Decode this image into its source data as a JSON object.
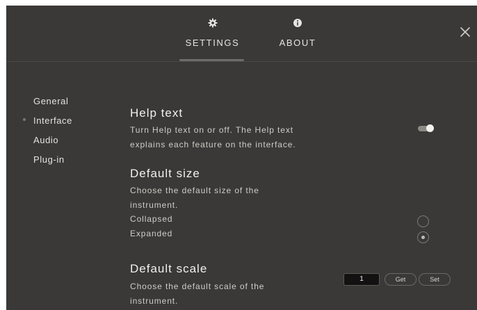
{
  "header": {
    "tabs": [
      {
        "label": "SETTINGS",
        "icon": "gear-icon"
      },
      {
        "label": "ABOUT",
        "icon": "info-icon"
      }
    ],
    "close_icon": "close-icon"
  },
  "sidebar": {
    "items": [
      {
        "label": "General"
      },
      {
        "label": "Interface",
        "active": true
      },
      {
        "label": "Audio"
      },
      {
        "label": "Plug-in"
      }
    ]
  },
  "help_text": {
    "title": "Help text",
    "description_lines": [
      "Turn Help text on or off. The Help text",
      "explains each feature on the interface."
    ],
    "toggle_on": true
  },
  "default_size": {
    "title": "Default size",
    "description_lines": [
      "Choose the default size of the",
      "instrument."
    ],
    "options": [
      {
        "label": "Collapsed",
        "selected": false
      },
      {
        "label": "Expanded",
        "selected": true
      }
    ]
  },
  "default_scale": {
    "title": "Default scale",
    "description_lines": [
      "Choose the default scale of the",
      "instrument."
    ],
    "value": "1",
    "get_label": "Get",
    "set_label": "Set"
  },
  "colors": {
    "panel_bg": "#3b3937",
    "text_primary": "#f2f0ec",
    "input_bg": "#131212"
  }
}
